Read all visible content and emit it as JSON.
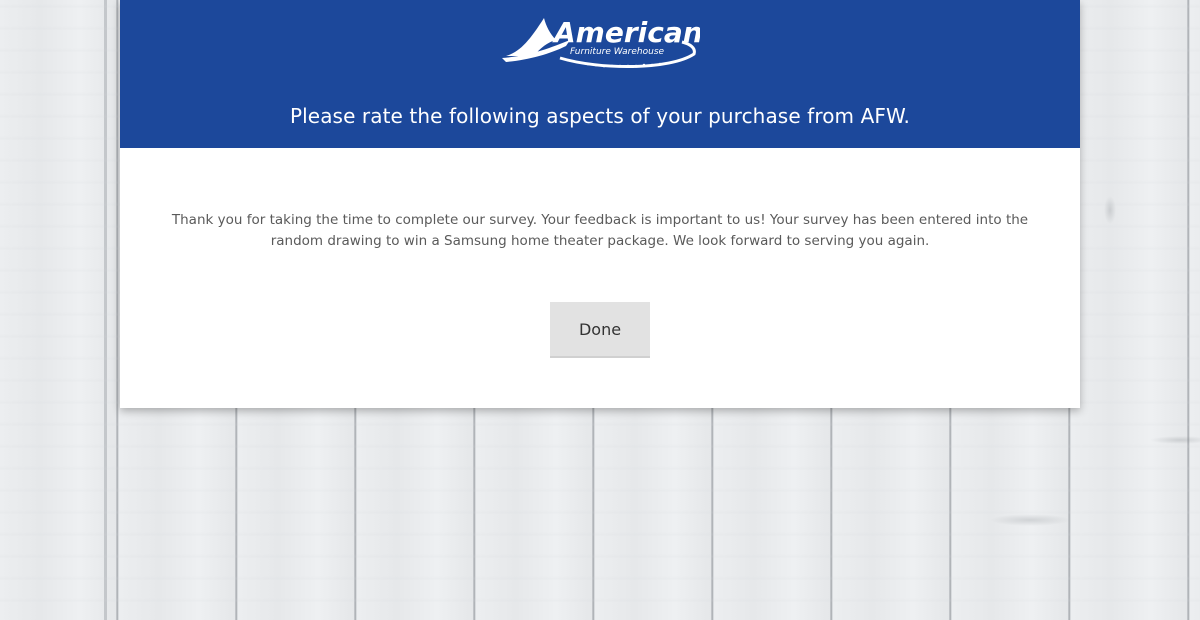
{
  "brand": {
    "logo_main": "American",
    "logo_sub": "Furniture Warehouse",
    "header_color": "#1c489b"
  },
  "header": {
    "title": "Please rate the following aspects of your purchase from AFW."
  },
  "content": {
    "message": "Thank you for taking the time to complete our survey. Your feedback is important to us! Your survey has been entered into the random drawing to win a Samsung home theater package. We look forward to serving you again."
  },
  "actions": {
    "done_label": "Done"
  },
  "background": {
    "style": "whitewashed wood planks"
  }
}
